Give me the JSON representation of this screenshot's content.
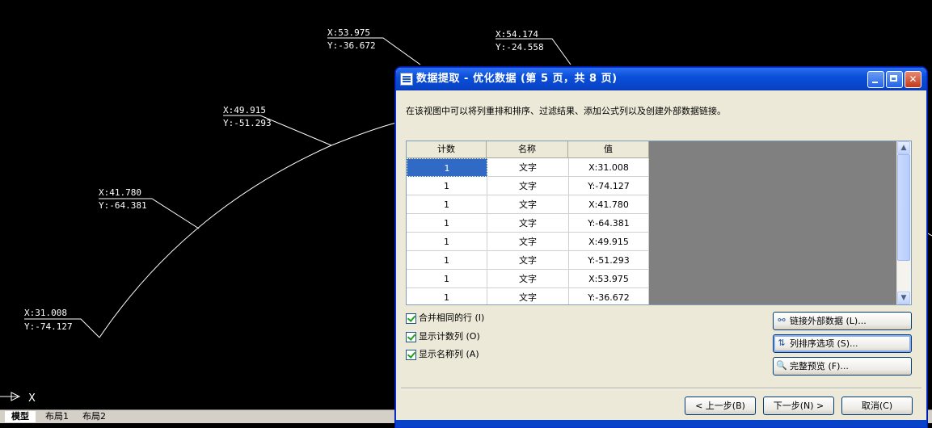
{
  "cad": {
    "labels": [
      {
        "x": "X:53.975",
        "y": "Y:-36.672"
      },
      {
        "x": "X:54.174",
        "y": "Y:-24.558"
      },
      {
        "x": "X:49.915",
        "y": "Y:-51.293"
      },
      {
        "x": "X:41.780",
        "y": "Y:-64.381"
      },
      {
        "x": "X:31.008",
        "y": "Y:-74.127"
      }
    ],
    "ucs_axis": "X"
  },
  "layout_tabs": [
    "模型",
    "布局1",
    "布局2"
  ],
  "dialog": {
    "title": "数据提取 - 优化数据 (第 5 页，共 8 页)",
    "instruction": "在该视图中可以将列重排和排序、过滤结果、添加公式列以及创建外部数据链接。",
    "columns": [
      "计数",
      "名称",
      "值"
    ],
    "rows": [
      {
        "count": "1",
        "name": "文字",
        "value": "X:31.008"
      },
      {
        "count": "1",
        "name": "文字",
        "value": "Y:-74.127"
      },
      {
        "count": "1",
        "name": "文字",
        "value": "X:41.780"
      },
      {
        "count": "1",
        "name": "文字",
        "value": "Y:-64.381"
      },
      {
        "count": "1",
        "name": "文字",
        "value": "X:49.915"
      },
      {
        "count": "1",
        "name": "文字",
        "value": "Y:-51.293"
      },
      {
        "count": "1",
        "name": "文字",
        "value": "X:53.975"
      },
      {
        "count": "1",
        "name": "文字",
        "value": "Y:-36.672"
      }
    ],
    "checkboxes": [
      {
        "label": "合并相同的行 (I)",
        "checked": true
      },
      {
        "label": "显示计数列 (O)",
        "checked": true
      },
      {
        "label": "显示名称列 (A)",
        "checked": true
      }
    ],
    "side_buttons": {
      "link": "链接外部数据 (L)...",
      "sort": "列排序选项 (S)...",
      "preview": "完整预览 (F)..."
    },
    "nav_buttons": {
      "back": "< 上一步(B)",
      "next": "下一步(N) >",
      "cancel": "取消(C)"
    }
  }
}
